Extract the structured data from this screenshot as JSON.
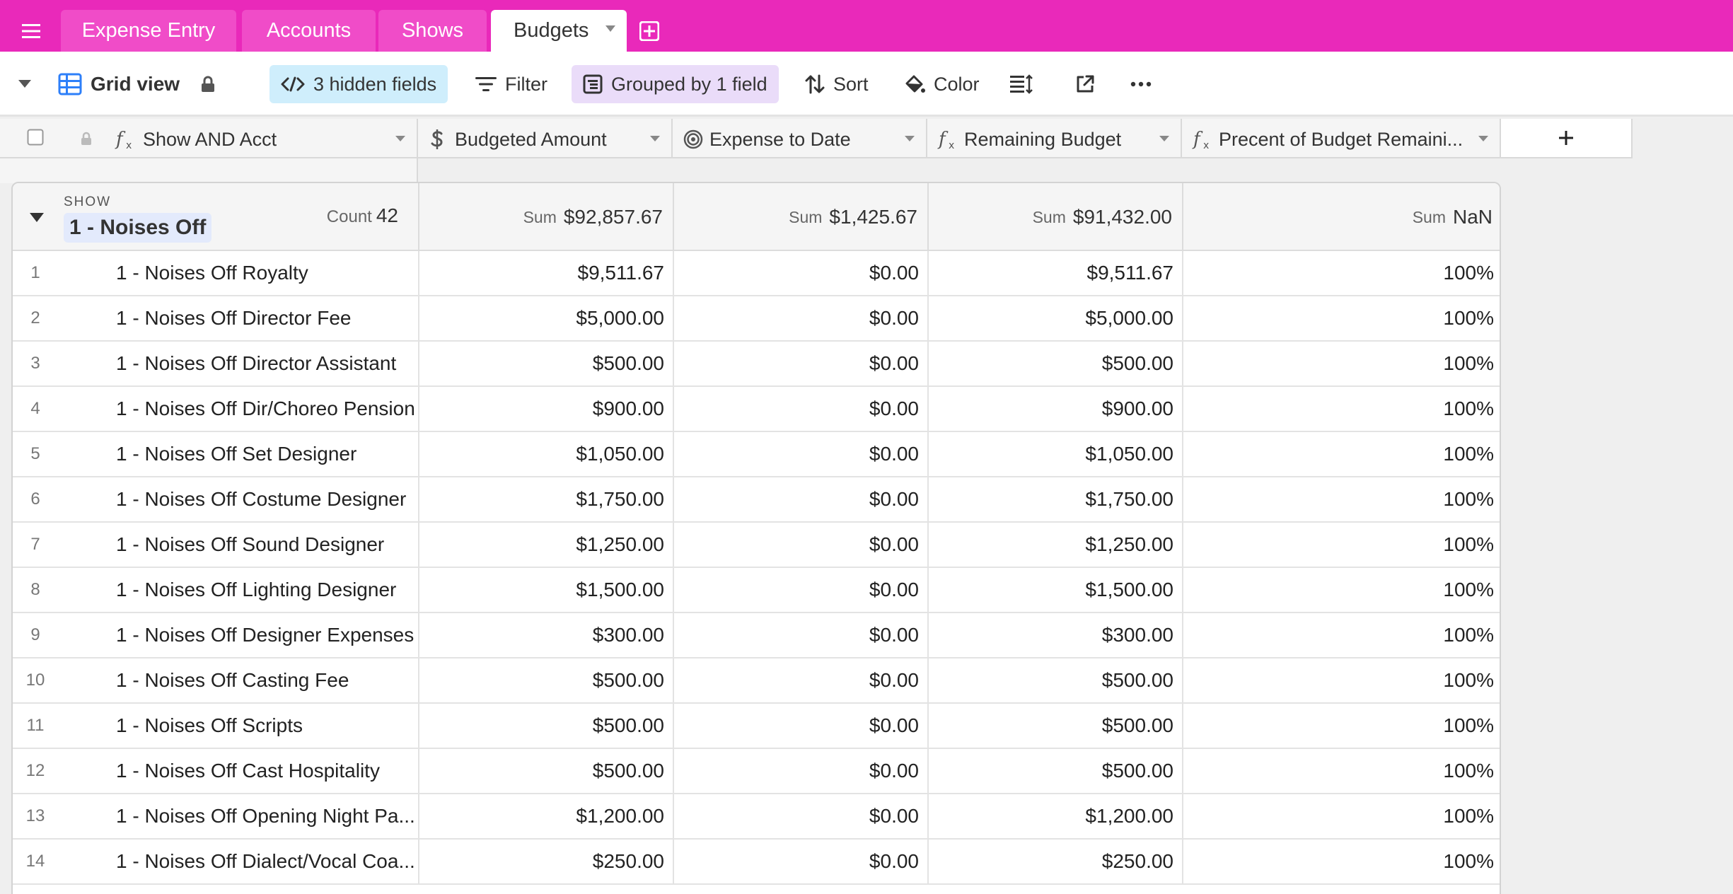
{
  "tabs": [
    {
      "label": "Expense Entry"
    },
    {
      "label": "Accounts"
    },
    {
      "label": "Shows"
    },
    {
      "label": "Budgets",
      "active": true
    }
  ],
  "toolbar": {
    "view_name": "Grid view",
    "hidden_fields": "3 hidden fields",
    "filter": "Filter",
    "grouped": "Grouped by 1 field",
    "sort": "Sort",
    "color": "Color"
  },
  "columns": [
    {
      "name": "Show AND Acct",
      "icon": "formula-icon"
    },
    {
      "name": "Budgeted Amount",
      "icon": "currency-icon"
    },
    {
      "name": "Expense to Date",
      "icon": "rollup-icon"
    },
    {
      "name": "Remaining Budget",
      "icon": "formula-icon"
    },
    {
      "name": "Precent of Budget Remaini...",
      "icon": "formula-icon"
    }
  ],
  "group": {
    "field": "SHOW",
    "value": "1 - Noises Off",
    "count_label": "Count",
    "count": "42",
    "sum_label": "Sum",
    "sums": [
      "$92,857.67",
      "$1,425.67",
      "$91,432.00",
      "NaN"
    ]
  },
  "rows": [
    {
      "n": "1",
      "name": "1 - Noises Off Royalty",
      "budget": "$9,511.67",
      "expense": "$0.00",
      "remaining": "$9,511.67",
      "pct": "100%"
    },
    {
      "n": "2",
      "name": "1 - Noises Off Director Fee",
      "budget": "$5,000.00",
      "expense": "$0.00",
      "remaining": "$5,000.00",
      "pct": "100%"
    },
    {
      "n": "3",
      "name": "1 - Noises Off Director Assistant",
      "budget": "$500.00",
      "expense": "$0.00",
      "remaining": "$500.00",
      "pct": "100%"
    },
    {
      "n": "4",
      "name": "1 - Noises Off Dir/Choreo Pension",
      "budget": "$900.00",
      "expense": "$0.00",
      "remaining": "$900.00",
      "pct": "100%"
    },
    {
      "n": "5",
      "name": "1 - Noises Off Set Designer",
      "budget": "$1,050.00",
      "expense": "$0.00",
      "remaining": "$1,050.00",
      "pct": "100%"
    },
    {
      "n": "6",
      "name": "1 - Noises Off Costume Designer",
      "budget": "$1,750.00",
      "expense": "$0.00",
      "remaining": "$1,750.00",
      "pct": "100%"
    },
    {
      "n": "7",
      "name": "1 - Noises Off Sound Designer",
      "budget": "$1,250.00",
      "expense": "$0.00",
      "remaining": "$1,250.00",
      "pct": "100%"
    },
    {
      "n": "8",
      "name": "1 - Noises Off Lighting Designer",
      "budget": "$1,500.00",
      "expense": "$0.00",
      "remaining": "$1,500.00",
      "pct": "100%"
    },
    {
      "n": "9",
      "name": "1 - Noises Off Designer Expenses",
      "budget": "$300.00",
      "expense": "$0.00",
      "remaining": "$300.00",
      "pct": "100%"
    },
    {
      "n": "10",
      "name": "1 - Noises Off Casting Fee",
      "budget": "$500.00",
      "expense": "$0.00",
      "remaining": "$500.00",
      "pct": "100%"
    },
    {
      "n": "11",
      "name": "1 - Noises Off Scripts",
      "budget": "$500.00",
      "expense": "$0.00",
      "remaining": "$500.00",
      "pct": "100%"
    },
    {
      "n": "12",
      "name": "1 - Noises Off Cast Hospitality",
      "budget": "$500.00",
      "expense": "$0.00",
      "remaining": "$500.00",
      "pct": "100%"
    },
    {
      "n": "13",
      "name": "1 - Noises Off Opening Night Pa...",
      "budget": "$1,200.00",
      "expense": "$0.00",
      "remaining": "$1,200.00",
      "pct": "100%"
    },
    {
      "n": "14",
      "name": "1 - Noises Off Dialect/Vocal Coa...",
      "budget": "$250.00",
      "expense": "$0.00",
      "remaining": "$250.00",
      "pct": "100%"
    }
  ]
}
